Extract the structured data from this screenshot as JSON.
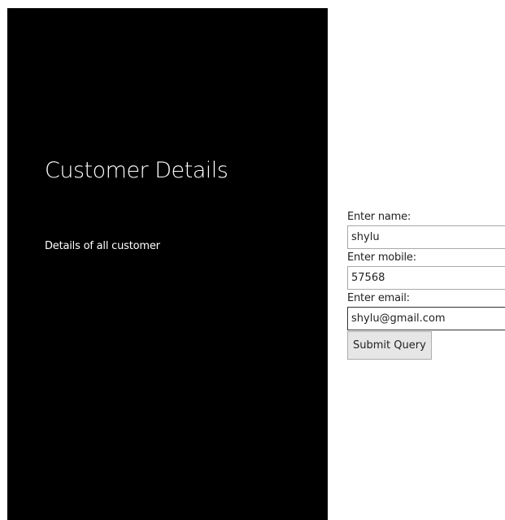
{
  "header": {
    "title": "Customer Details",
    "subtitle": "Details of all customer"
  },
  "form": {
    "name": {
      "label": "Enter name:",
      "value": "shylu"
    },
    "mobile": {
      "label": "Enter mobile:",
      "value": "57568"
    },
    "email": {
      "label": "Enter email:",
      "value": "shylu@gmail.com"
    },
    "submit_label": "Submit Query"
  },
  "colors": {
    "panel_background": "#000000",
    "panel_text": "#ffffff",
    "page_background": "#ffffff",
    "button_background": "#e6e6e6"
  }
}
